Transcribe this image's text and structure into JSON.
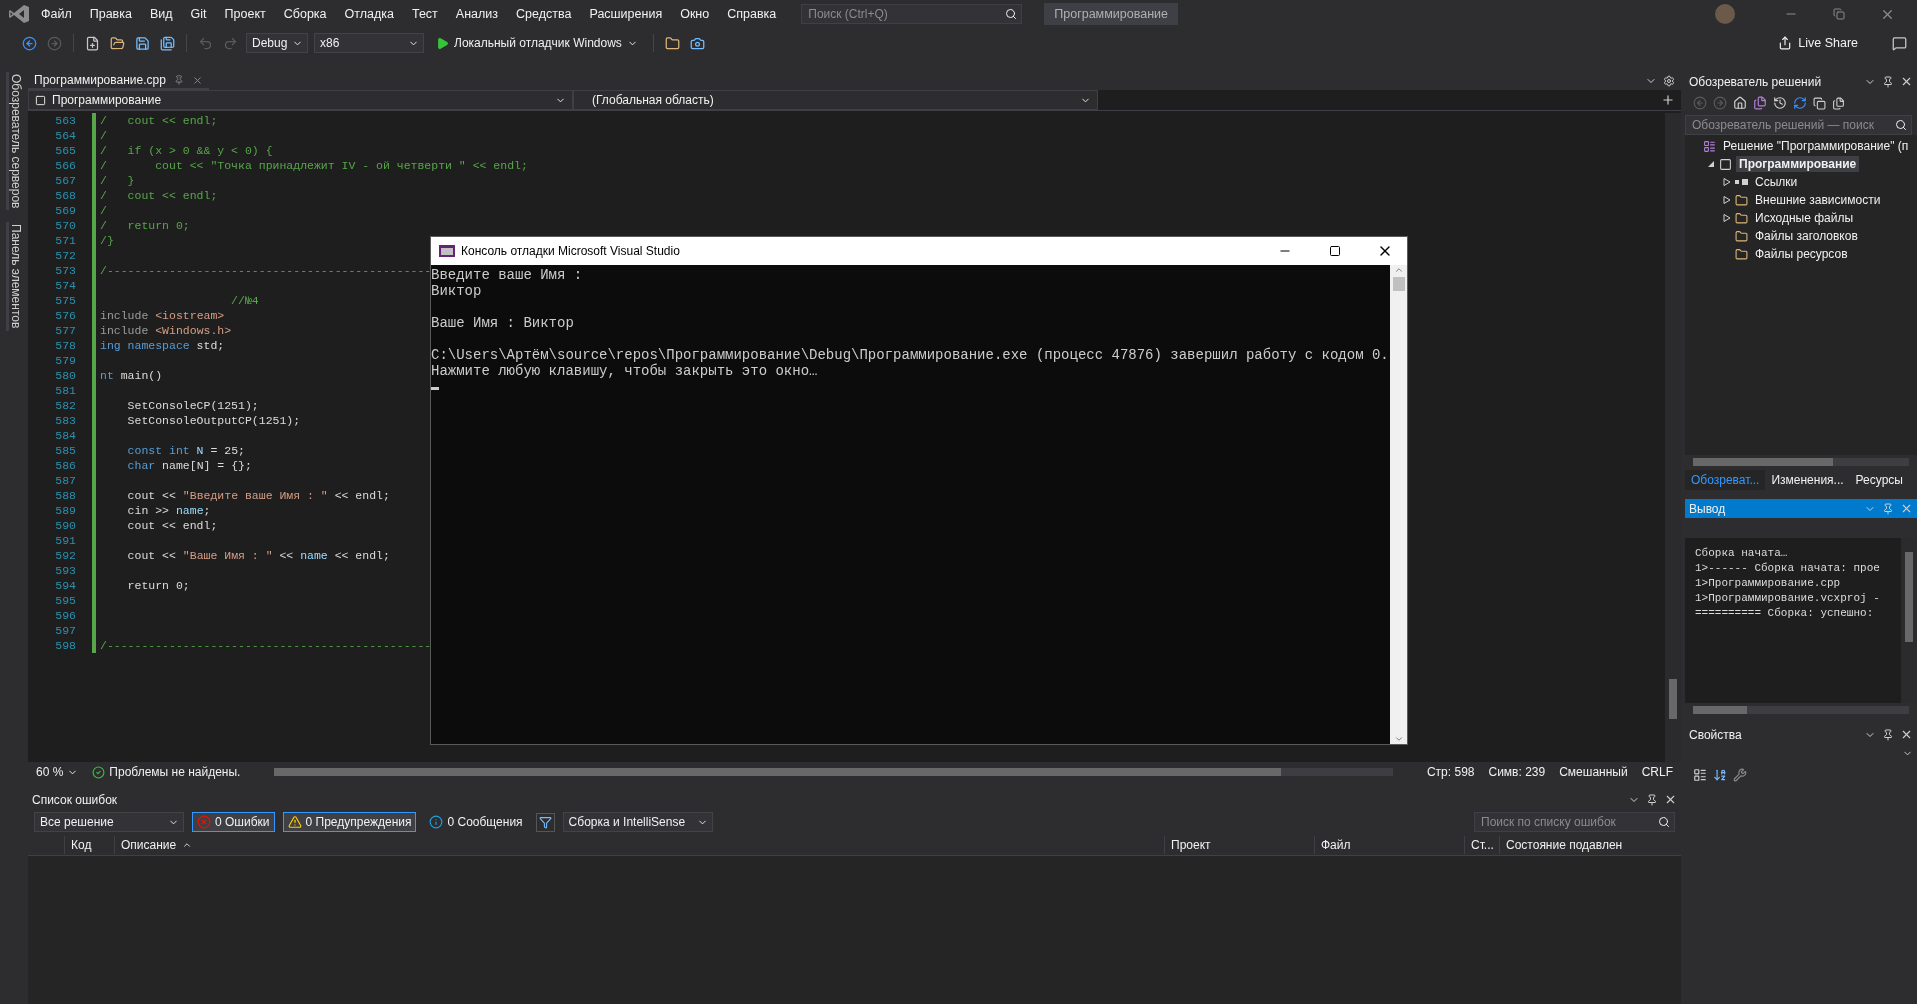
{
  "menu_bar": {
    "items": [
      "Файл",
      "Правка",
      "Вид",
      "Git",
      "Проект",
      "Сборка",
      "Отладка",
      "Тест",
      "Анализ",
      "Средства",
      "Расширения",
      "Окно",
      "Справка"
    ],
    "search": {
      "placeholder": "Поиск (Ctrl+Q)"
    },
    "solution_name": "Программирование"
  },
  "toolbar": {
    "configuration": "Debug",
    "platform": "x86",
    "run_label": "Локальный отладчик Windows",
    "live_share": "Live Share"
  },
  "side_strip": [
    "Обозреватель серверов",
    "Панель элементов"
  ],
  "editor": {
    "tab": {
      "label": "Программирование.cpp"
    },
    "project_dropdown": "Программирование",
    "scope_dropdown": "(Глобальная область)",
    "lines": [
      {
        "number": "563",
        "tokens": [
          {
            "kind": "comment",
            "text": "/   cout << endl;"
          }
        ]
      },
      {
        "number": "564",
        "tokens": [
          {
            "kind": "comment",
            "text": "/"
          }
        ]
      },
      {
        "number": "565",
        "tokens": [
          {
            "kind": "comment",
            "text": "/   if (x > 0 && y < 0) {"
          }
        ]
      },
      {
        "number": "566",
        "tokens": [
          {
            "kind": "comment",
            "text": "/       cout << \"Точка принадлежит IV - ой четверти \" << endl;"
          }
        ]
      },
      {
        "number": "567",
        "tokens": [
          {
            "kind": "comment",
            "text": "/   }"
          }
        ]
      },
      {
        "number": "568",
        "tokens": [
          {
            "kind": "comment",
            "text": "/   cout << endl;"
          }
        ]
      },
      {
        "number": "569",
        "tokens": [
          {
            "kind": "comment",
            "text": "/"
          }
        ]
      },
      {
        "number": "570",
        "tokens": [
          {
            "kind": "comment",
            "text": "/   return 0;"
          }
        ]
      },
      {
        "number": "571",
        "tokens": [
          {
            "kind": "comment",
            "text": "/}"
          }
        ]
      },
      {
        "number": "572"
      },
      {
        "number": "573",
        "tokens": [
          {
            "kind": "comment",
            "text": "/-----------------------------------------------"
          }
        ]
      },
      {
        "number": "574"
      },
      {
        "number": "575",
        "tokens": [
          {
            "kind": "comment",
            "text": "                   //№4"
          }
        ]
      },
      {
        "number": "576",
        "tokens": [
          {
            "kind": "preproc",
            "text": "include "
          },
          {
            "kind": "string",
            "text": "<iostream>"
          }
        ]
      },
      {
        "number": "577",
        "tokens": [
          {
            "kind": "preproc",
            "text": "include "
          },
          {
            "kind": "string",
            "text": "<Windows.h>"
          }
        ]
      },
      {
        "number": "578",
        "tokens": [
          {
            "kind": "keyword",
            "text": "ing namespace"
          },
          {
            "kind": "plain",
            "text": " std;"
          }
        ]
      },
      {
        "number": "579"
      },
      {
        "number": "580",
        "tokens": [
          {
            "kind": "keyword",
            "text": "nt"
          },
          {
            "kind": "plain",
            "text": " main()"
          }
        ]
      },
      {
        "number": "581"
      },
      {
        "number": "582",
        "tokens": [
          {
            "kind": "plain",
            "text": "    SetConsoleCP(1251);"
          }
        ]
      },
      {
        "number": "583",
        "tokens": [
          {
            "kind": "plain",
            "text": "    SetConsoleOutputCP(1251);"
          }
        ]
      },
      {
        "number": "584"
      },
      {
        "number": "585",
        "tokens": [
          {
            "kind": "keyword",
            "text": "    const int"
          },
          {
            "kind": "ident",
            "text": " N"
          },
          {
            "kind": "plain",
            "text": " = 25;"
          }
        ]
      },
      {
        "number": "586",
        "tokens": [
          {
            "kind": "keyword",
            "text": "    char"
          },
          {
            "kind": "plain",
            "text": " name[N] = {};"
          }
        ]
      },
      {
        "number": "587"
      },
      {
        "number": "588",
        "tokens": [
          {
            "kind": "plain",
            "text": "    cout << "
          },
          {
            "kind": "string",
            "text": "\"Введите ваше Имя : \""
          },
          {
            "kind": "plain",
            "text": " << endl;"
          }
        ]
      },
      {
        "number": "589",
        "tokens": [
          {
            "kind": "plain",
            "text": "    cin >> "
          },
          {
            "kind": "ident",
            "text": "name"
          },
          {
            "kind": "plain",
            "text": ";"
          }
        ]
      },
      {
        "number": "590",
        "tokens": [
          {
            "kind": "plain",
            "text": "    cout << endl;"
          }
        ]
      },
      {
        "number": "591"
      },
      {
        "number": "592",
        "tokens": [
          {
            "kind": "plain",
            "text": "    cout << "
          },
          {
            "kind": "string",
            "text": "\"Ваше Имя : \""
          },
          {
            "kind": "plain",
            "text": " << "
          },
          {
            "kind": "ident",
            "text": "name"
          },
          {
            "kind": "plain",
            "text": " << endl;"
          }
        ]
      },
      {
        "number": "593"
      },
      {
        "number": "594",
        "tokens": [
          {
            "kind": "plain",
            "text": "    return 0;"
          }
        ]
      },
      {
        "number": "595"
      },
      {
        "number": "596"
      },
      {
        "number": "597"
      },
      {
        "number": "598",
        "tokens": [
          {
            "kind": "comment",
            "text": "/-----------------------------------------------"
          }
        ]
      }
    ],
    "status": {
      "zoom": "60 %",
      "issues": "Проблемы не найдены.",
      "position": [
        "Стр: 598",
        "Симв: 239",
        "Смешанный",
        "CRLF"
      ]
    }
  },
  "error_list": {
    "title": "Список ошибок",
    "scope": "Все решение",
    "filters": [
      {
        "kind": "error",
        "label": "0 Ошибки",
        "selected": true
      },
      {
        "kind": "warning",
        "label": "0 Предупреждения",
        "selected": true
      },
      {
        "kind": "info",
        "label": "0 Сообщения",
        "selected": false
      }
    ],
    "source": "Сборка и IntelliSense",
    "search": {
      "placeholder": "Поиск по списку ошибок"
    },
    "columns": [
      "Код",
      "Описание",
      "Проект",
      "Файл",
      "Ст...",
      "Состояние подавлен"
    ]
  },
  "solution_explorer": {
    "title": "Обозреватель решений",
    "search": {
      "placeholder": "Обозреватель решений — поиск"
    },
    "tree": [
      {
        "label": "Решение \"Программирование\" (п",
        "kind": "solution",
        "selected": false,
        "children": [
          {
            "label": "Программирование",
            "kind": "project",
            "expanded": true,
            "selected": true,
            "children": [
              {
                "label": "Ссылки",
                "kind": "refs",
                "expanded": false,
                "selected": false
              },
              {
                "label": "Внешние зависимости",
                "kind": "folder",
                "expanded": false,
                "selected": false
              },
              {
                "label": "Исходные файлы",
                "kind": "folder",
                "expanded": false,
                "selected": false
              },
              {
                "label": "Файлы заголовков",
                "kind": "folder",
                "selected": false
              },
              {
                "label": "Файлы ресурсов",
                "kind": "folder",
                "selected": false
              }
            ]
          }
        ]
      }
    ],
    "tabs": [
      {
        "label": "Обозреват...",
        "selected": true
      },
      {
        "label": "Изменения...",
        "selected": false
      },
      {
        "label": "Ресурсы",
        "selected": false
      }
    ]
  },
  "output": {
    "title": "Вывод",
    "lines": [
      "Сборка начата…",
      "1>------ Сборка начата: прое",
      "1>Программирование.cpp",
      "1>Программирование.vcxproj -",
      "========== Сборка: успешно:"
    ]
  },
  "properties": {
    "title": "Свойства"
  },
  "console": {
    "title": "Консоль отладки Microsoft Visual Studio",
    "blocks": [
      [
        "Введите ваше Имя :",
        "Виктор"
      ],
      [
        "Ваше Имя : Виктор"
      ],
      [
        "C:\\Users\\Артём\\source\\repos\\Программирование\\Debug\\Программирование.exe (процесс 47876) завершил работу с кодом 0.",
        "Нажмите любую клавишу, чтобы закрыть это окно…"
      ]
    ]
  }
}
